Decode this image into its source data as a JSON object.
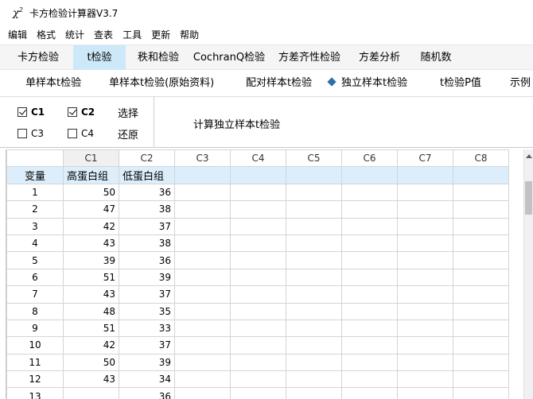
{
  "window": {
    "icon_text": "χ",
    "icon_sup": "2",
    "title": "卡方检验计算器V3.7"
  },
  "menu": [
    "编辑",
    "格式",
    "统计",
    "查表",
    "工具",
    "更新",
    "帮助"
  ],
  "main_tabs": [
    "卡方检验",
    "t检验",
    "秩和检验",
    "CochranQ检验",
    "方差齐性检验",
    "方差分析",
    "随机数"
  ],
  "main_tabs_active": "t检验",
  "sub_tabs": [
    "单样本t检验",
    "单样本t检验(原始资料)",
    "配对样本t检验",
    "独立样本t检验",
    "t检验P值",
    "示例"
  ],
  "sub_tabs_selected": "独立样本t检验",
  "options": {
    "c1": {
      "label": "C1",
      "checked": true
    },
    "c2": {
      "label": "C2",
      "checked": true
    },
    "c3": {
      "label": "C3",
      "checked": false
    },
    "c4": {
      "label": "C4",
      "checked": false
    },
    "select_label": "选择",
    "restore_label": "还原",
    "run_label": "计算独立样本t检验"
  },
  "grid": {
    "columns": [
      "C1",
      "C2",
      "C3",
      "C4",
      "C5",
      "C6",
      "C7",
      "C8"
    ],
    "selected_column": "C1",
    "name_row_label": "变量",
    "variable_names": [
      "高蛋白组",
      "低蛋白组",
      "",
      "",
      "",
      "",
      "",
      ""
    ],
    "rows": [
      {
        "n": "1",
        "c1": "50",
        "c2": "36"
      },
      {
        "n": "2",
        "c1": "47",
        "c2": "38"
      },
      {
        "n": "3",
        "c1": "42",
        "c2": "37"
      },
      {
        "n": "4",
        "c1": "43",
        "c2": "38"
      },
      {
        "n": "5",
        "c1": "39",
        "c2": "36"
      },
      {
        "n": "6",
        "c1": "51",
        "c2": "39"
      },
      {
        "n": "7",
        "c1": "43",
        "c2": "37"
      },
      {
        "n": "8",
        "c1": "48",
        "c2": "35"
      },
      {
        "n": "9",
        "c1": "51",
        "c2": "33"
      },
      {
        "n": "10",
        "c1": "42",
        "c2": "37"
      },
      {
        "n": "11",
        "c1": "50",
        "c2": "39"
      },
      {
        "n": "12",
        "c1": "43",
        "c2": "34"
      },
      {
        "n": "13",
        "c1": "",
        "c2": "36"
      }
    ]
  },
  "colors": {
    "active_tab": "#cde8f8",
    "name_row": "#dceefb",
    "diamond": "#2e6fa8"
  }
}
